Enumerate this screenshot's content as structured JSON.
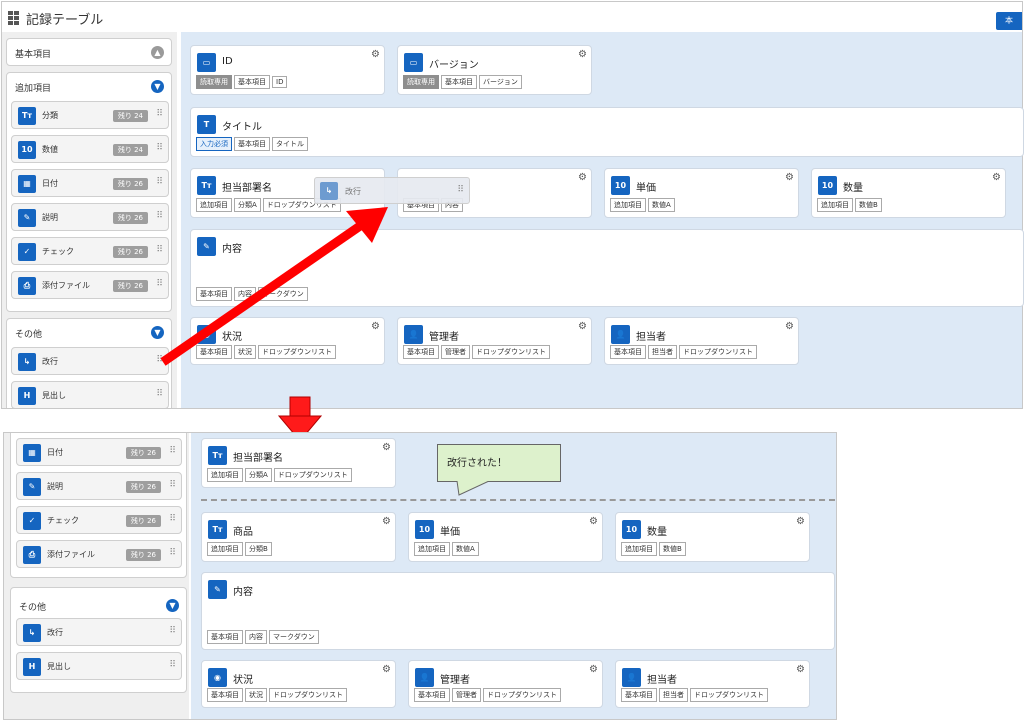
{
  "header": {
    "title": "記録テーブル",
    "right_button": "本"
  },
  "top": {
    "groups": {
      "basic": "基本項目",
      "additional": "追加項目",
      "other": "その他"
    },
    "items": [
      {
        "icon": "Tт",
        "label": "分類",
        "badge": "残り 24"
      },
      {
        "icon": "10",
        "label": "数値",
        "badge": "残り 24"
      },
      {
        "icon": "▦",
        "label": "日付",
        "badge": "残り 26"
      },
      {
        "icon": "✎",
        "label": "説明",
        "badge": "残り 26"
      },
      {
        "icon": "✓",
        "label": "チェック",
        "badge": "残り 26"
      },
      {
        "icon": "⎙",
        "label": "添付ファイル",
        "badge": "残り 26"
      }
    ],
    "other_items": [
      {
        "icon": "↳",
        "label": "改行"
      },
      {
        "icon": "H",
        "label": "見出し"
      }
    ],
    "cards": {
      "id": {
        "title": "ID",
        "tags": [
          "読取専用",
          "基本項目",
          "ID"
        ]
      },
      "version": {
        "title": "バージョン",
        "tags": [
          "読取専用",
          "基本項目",
          "バージョン"
        ]
      },
      "title_field": {
        "title": "タイトル",
        "tags": [
          "入力必須",
          "基本項目",
          "タイトル"
        ]
      },
      "dept": {
        "title": "担当部署名",
        "tags": [
          "追加項目",
          "分類A",
          "ドロップダウンリスト"
        ]
      },
      "product": {
        "tags": [
          "基本項目",
          "内容"
        ]
      },
      "price": {
        "title": "単価",
        "tags": [
          "追加項目",
          "数値A"
        ]
      },
      "qty": {
        "title": "数量",
        "tags": [
          "追加項目",
          "数値B"
        ]
      },
      "content": {
        "title": "内容",
        "tags": [
          "基本項目",
          "内容",
          "マークダウン"
        ]
      },
      "status": {
        "title": "状況",
        "tags": [
          "基本項目",
          "状況",
          "ドロップダウンリスト"
        ]
      },
      "manager": {
        "title": "管理者",
        "tags": [
          "基本項目",
          "管理者",
          "ドロップダウンリスト"
        ]
      },
      "owner": {
        "title": "担当者",
        "tags": [
          "基本項目",
          "担当者",
          "ドロップダウンリスト"
        ]
      }
    },
    "drag_ghost": {
      "label": "改行"
    }
  },
  "bottom": {
    "items": [
      {
        "icon": "▦",
        "label": "日付",
        "badge": "残り 26"
      },
      {
        "icon": "✎",
        "label": "説明",
        "badge": "残り 26"
      },
      {
        "icon": "✓",
        "label": "チェック",
        "badge": "残り 26"
      },
      {
        "icon": "⎙",
        "label": "添付ファイル",
        "badge": "残り 26"
      }
    ],
    "other_group": "その他",
    "other_items": [
      {
        "icon": "↳",
        "label": "改行"
      },
      {
        "icon": "H",
        "label": "見出し"
      }
    ],
    "cards": {
      "dept": {
        "title": "担当部署名",
        "tags": [
          "追加項目",
          "分類A",
          "ドロップダウンリスト"
        ]
      },
      "product": {
        "title": "商品",
        "tags": [
          "追加項目",
          "分類B"
        ]
      },
      "price": {
        "title": "単価",
        "tags": [
          "追加項目",
          "数値A"
        ]
      },
      "qty": {
        "title": "数量",
        "tags": [
          "追加項目",
          "数値B"
        ]
      },
      "content": {
        "title": "内容",
        "tags": [
          "基本項目",
          "内容",
          "マークダウン"
        ]
      },
      "status": {
        "title": "状況",
        "tags": [
          "基本項目",
          "状況",
          "ドロップダウンリスト"
        ]
      },
      "manager": {
        "title": "管理者",
        "tags": [
          "基本項目",
          "管理者",
          "ドロップダウンリスト"
        ]
      },
      "owner": {
        "title": "担当者",
        "tags": [
          "基本項目",
          "担当者",
          "ドロップダウンリスト"
        ]
      }
    },
    "callout": "改行された！"
  },
  "colors": {
    "accent": "#1565c0",
    "arrow": "#ff0000",
    "callout_bg": "#ddf1cc",
    "canvas": "#dde9f6"
  }
}
